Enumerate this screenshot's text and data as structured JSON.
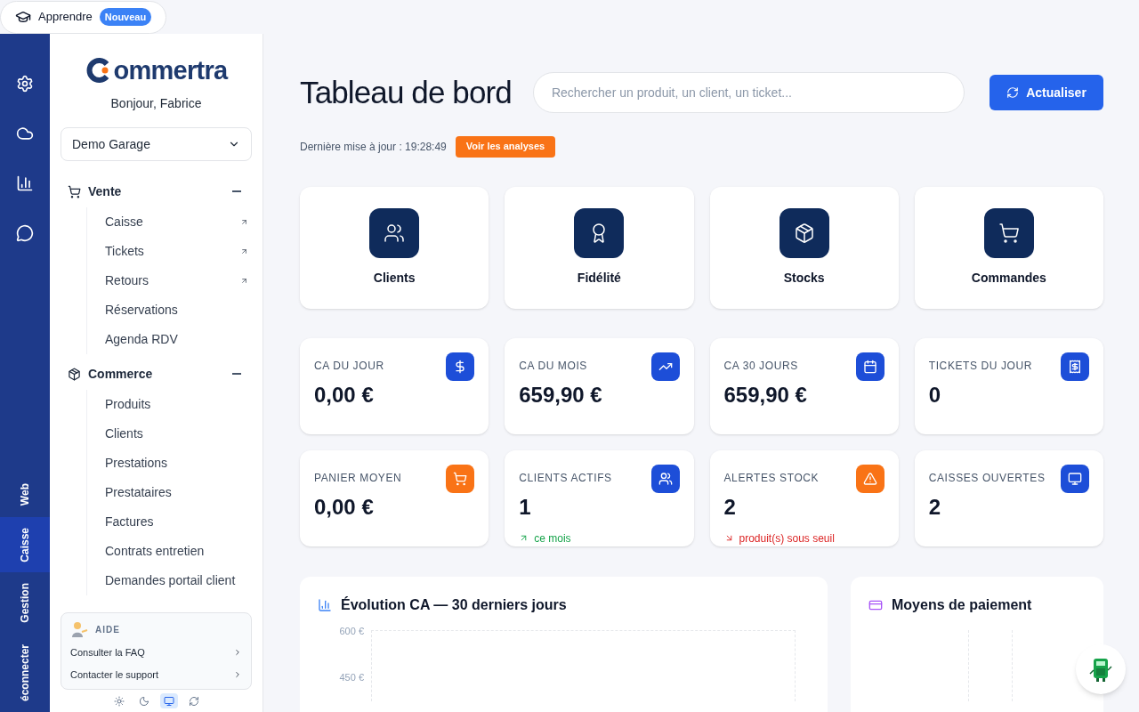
{
  "learn_pill": {
    "label": "Apprendre",
    "badge": "Nouveau"
  },
  "rail": {
    "tabs": [
      {
        "label": "Web",
        "selected": false
      },
      {
        "label": "Caisse",
        "selected": true
      },
      {
        "label": "Gestion",
        "selected": false
      },
      {
        "label": "éconnecter",
        "selected": false
      }
    ]
  },
  "sidebar": {
    "logo": "ommertra",
    "greeting": "Bonjour, Fabrice",
    "store": "Demo Garage",
    "sections": [
      {
        "label": "Vente",
        "expanded": true,
        "children": [
          {
            "label": "Caisse",
            "external": true
          },
          {
            "label": "Tickets",
            "external": true
          },
          {
            "label": "Retours",
            "external": true
          },
          {
            "label": "Réservations",
            "external": false
          },
          {
            "label": "Agenda RDV",
            "external": false
          }
        ]
      },
      {
        "label": "Commerce",
        "expanded": true,
        "children": [
          {
            "label": "Produits",
            "external": false
          },
          {
            "label": "Clients",
            "external": false
          },
          {
            "label": "Prestations",
            "external": false
          },
          {
            "label": "Prestataires",
            "external": false
          },
          {
            "label": "Factures",
            "external": false
          },
          {
            "label": "Contrats entretien",
            "external": false
          },
          {
            "label": "Demandes portail client",
            "external": false
          }
        ]
      }
    ],
    "help": {
      "title": "AIDE",
      "links": [
        "Consulter la FAQ",
        "Contacter le support"
      ]
    },
    "themes": [
      {
        "selected": false
      },
      {
        "selected": false
      },
      {
        "selected": true
      },
      {
        "selected": false
      }
    ]
  },
  "header": {
    "title": "Tableau de bord",
    "search": {
      "placeholder": "Rechercher un produit, un client, un ticket..."
    },
    "refresh": "Actualiser",
    "updated": "Dernière mise à jour : 19:28:49",
    "analyses": "Voir les analyses"
  },
  "shortcuts": [
    {
      "label": "Clients"
    },
    {
      "label": "Fidélité"
    },
    {
      "label": "Stocks"
    },
    {
      "label": "Commandes"
    }
  ],
  "stats": [
    {
      "label": "CA DU JOUR",
      "value": "0,00 €",
      "color": "#1d4ed8"
    },
    {
      "label": "CA DU MOIS",
      "value": "659,90 €",
      "color": "#1d4ed8"
    },
    {
      "label": "CA 30 JOURS",
      "value": "659,90 €",
      "color": "#1d4ed8"
    },
    {
      "label": "TICKETS DU JOUR",
      "value": "0",
      "color": "#1d4ed8"
    },
    {
      "label": "PANIER MOYEN",
      "value": "0,00 €",
      "color": "#f97316"
    },
    {
      "label": "CLIENTS ACTIFS",
      "value": "1",
      "color": "#1d4ed8",
      "trend": {
        "kind": "up",
        "text": "ce mois"
      }
    },
    {
      "label": "ALERTES STOCK",
      "value": "2",
      "color": "#f97316",
      "trend": {
        "kind": "down",
        "text": "produit(s) sous seuil"
      }
    },
    {
      "label": "CAISSES OUVERTES",
      "value": "2",
      "color": "#1d4ed8"
    }
  ],
  "panels": [
    {
      "title": "Évolution CA — 30 derniers jours",
      "axis_labels": [
        "600 €",
        "450 €"
      ]
    },
    {
      "title": "Moyens de paiement"
    }
  ]
}
